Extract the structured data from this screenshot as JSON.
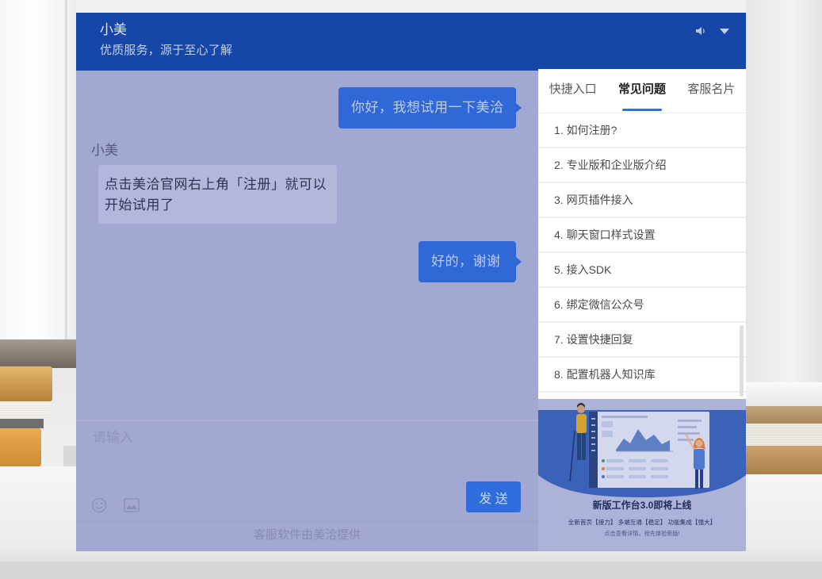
{
  "colors": {
    "header_bg": "#1647a6",
    "overlay": "#a3a8d2",
    "bubble_visitor": "#3168d8",
    "bubble_agent": "#b3b7dc",
    "send_button": "#2f6ddc",
    "accent": "#2c6fe8",
    "panel_bg": "#ffffff"
  },
  "header": {
    "title": "小美",
    "subtitle": "优质服务，源于至心了解",
    "icons": {
      "sound": "speaker-icon",
      "collapse": "chevron-down-icon"
    }
  },
  "messages": [
    {
      "visitor": "你好，我想试用一下美洽"
    },
    {
      "agent": "小美",
      "lines": [
        "点击美洽官网右上角「注册」就可以",
        "开始试用了"
      ]
    },
    {
      "visitor": "好的，谢谢"
    }
  ],
  "composer": {
    "placeholder": "请输入",
    "send_label": "发 送",
    "icons": {
      "emoji": "smile-icon",
      "image": "image-icon"
    }
  },
  "footer": {
    "text": "客服软件由美洽提供"
  },
  "side_panel": {
    "tabs": [
      {
        "label": "快捷入口",
        "active": false
      },
      {
        "label": "常见问题",
        "active": true
      },
      {
        "label": "客服名片",
        "active": false
      }
    ],
    "faq": [
      "1. 如何注册?",
      "2. 专业版和企业版介绍",
      "3. 网页插件接入",
      "4. 聊天窗口样式设置",
      "5. 接入SDK",
      "6. 绑定微信公众号",
      "7. 设置快捷回复",
      "8. 配置机器人知识库"
    ]
  },
  "banner": {
    "title": "新版工作台3.0即将上线",
    "features": "全新首页【接力】 多端互通【稳定】 功能集成【强大】",
    "cta": "点击查看详情，抢先体验新版!"
  }
}
